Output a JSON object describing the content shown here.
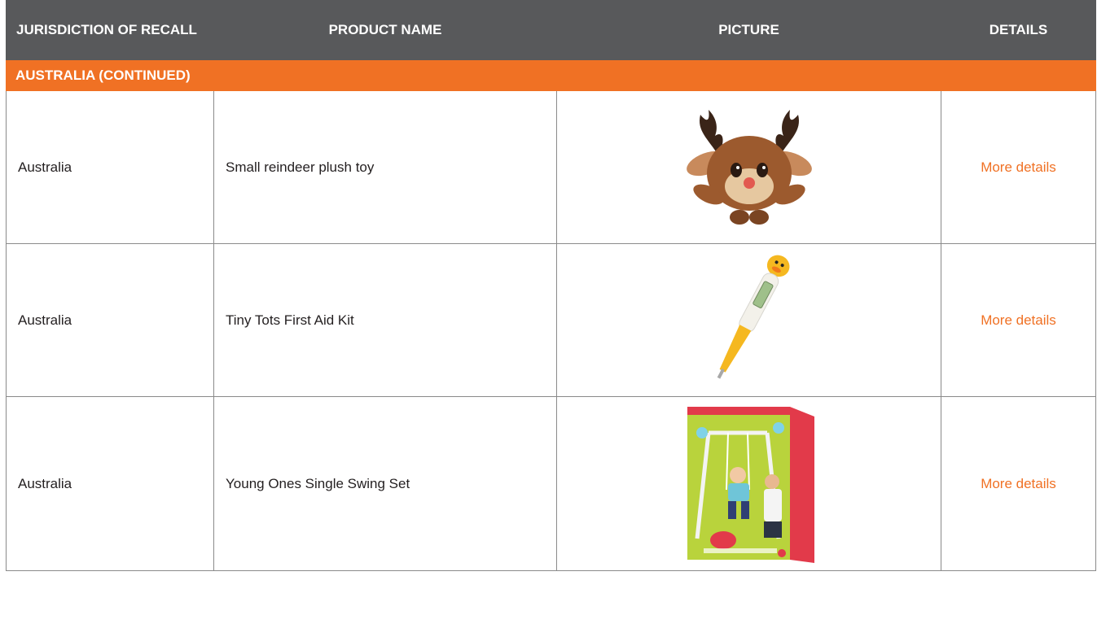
{
  "table": {
    "headers": [
      "JURISDICTION OF RECALL",
      "PRODUCT NAME",
      "PICTURE",
      "DETAILS"
    ],
    "section_label": "AUSTRALIA (CONTINUED)",
    "rows": [
      {
        "jurisdiction": "Australia",
        "product": "Small reindeer plush toy",
        "picture_icon": "reindeer-plush-image",
        "details_link": "More details"
      },
      {
        "jurisdiction": "Australia",
        "product": "Tiny Tots First Aid Kit",
        "picture_icon": "thermometer-image",
        "details_link": "More details"
      },
      {
        "jurisdiction": "Australia",
        "product": "Young Ones Single Swing Set",
        "picture_icon": "swing-set-box-image",
        "details_link": "More details"
      }
    ]
  },
  "colors": {
    "header_bg": "#58595b",
    "accent": "#f07124",
    "text": "#231f20"
  }
}
